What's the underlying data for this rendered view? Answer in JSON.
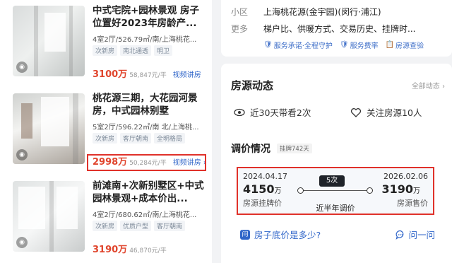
{
  "listings": [
    {
      "title": "中式宅院+园林景观 房子位置好2023年房龄产...",
      "spec": "4室2厅/526.79㎡/南/上海桃花...",
      "tags": [
        "次新房",
        "南北通透",
        "明卫"
      ],
      "price": "3100万",
      "unit_price": "58,847元/平",
      "video": "视频讲房"
    },
    {
      "title": "桃花源三期，大花园河景房，中式园林别墅",
      "spec": "5室2厅/596.22㎡/南 北/上海桃...",
      "tags": [
        "次新房",
        "客厅朝南",
        "全明格局"
      ],
      "price": "2998万",
      "unit_price": "50,284元/平",
      "video": "视频讲房 ›"
    },
    {
      "title": "前滩南+次新别墅区+中式园林景观+成本价出...",
      "spec": "4室2厅/680.62㎡/南/上海桃花...",
      "tags": [
        "次新房",
        "优质户型",
        "客厅朝南"
      ],
      "price": "3190万",
      "unit_price": "46,870元/平",
      "video": ""
    }
  ],
  "info": {
    "community_label": "小区",
    "community_value": "上海桃花源(金宇园)(闵行·浦江)",
    "more_label": "更多",
    "more_value": "梯户比、供暖方式、交易历史、挂牌时...",
    "badges": [
      "服务承诺·全程守护",
      "服务费率",
      "房源查验"
    ]
  },
  "activity": {
    "title": "房源动态",
    "all_link": "全部动态 ›",
    "visits": "近30天带看2次",
    "followers": "关注房源10人"
  },
  "price_history": {
    "title": "调价情况",
    "listing_days": "挂牌742天",
    "start_date": "2024.04.17",
    "start_price_num": "4150",
    "start_price_unit": "万",
    "start_label": "房源挂牌价",
    "change_count": "5次",
    "middle_label": "近半年调价",
    "end_date": "2026.02.06",
    "end_price_num": "3190",
    "end_price_unit": "万",
    "end_label": "房源售价"
  },
  "question": {
    "text": "房子底价是多少?",
    "ask": "问一问"
  },
  "colors": {
    "price_red": "#e0452d",
    "link_blue": "#3066c9",
    "highlight_border": "#e0312a"
  }
}
